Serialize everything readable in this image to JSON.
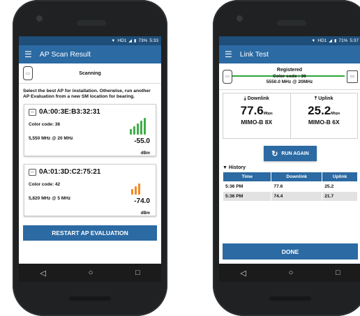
{
  "left": {
    "status": {
      "network": "HD1",
      "battery": "73%",
      "time": "5:33"
    },
    "appbar_title": "AP Scan Result",
    "scan_status": "Scanning",
    "instructions": "Select the best AP for installation. Otherwise, run another AP Evaluation from a new SM location for bearing.",
    "ap_list": [
      {
        "mac": "0A:00:3E:B3:32:31",
        "color_code": "Color code: 36",
        "freq": "5,550 MHz @ 20 MHz",
        "rssi": "-55.0",
        "unit": "dBm",
        "signal_color": "#3fae49",
        "bars": 5
      },
      {
        "mac": "0A:01:3D:C2:75:21",
        "color_code": "Color code: 42",
        "freq": "5,820 MHz @ 5 MHz",
        "rssi": "-74.0",
        "unit": "dBm",
        "signal_color": "#f08a24",
        "bars": 3
      }
    ],
    "restart_label": "RESTART AP EVALUATION",
    "nav": {
      "back": "◁",
      "home": "○",
      "recent": "□"
    }
  },
  "right": {
    "status": {
      "network": "HD1",
      "battery": "71%",
      "time": "5:37"
    },
    "appbar_title": "Link Test",
    "reg_status": "Registered",
    "color_code": "Color code : 36",
    "freq": "5550.0 MHz @ 20MHz",
    "downlink": {
      "label": "Downlink",
      "value": "77.6",
      "unit": "Mbps",
      "mimo": "MIMO-B 8X"
    },
    "uplink": {
      "label": "Uplink",
      "value": "25.2",
      "unit": "Mbps",
      "mimo": "MIMO-B 6X"
    },
    "run_again_label": "RUN AGAIN",
    "history_label": "History",
    "history_headers": [
      "Time",
      "Downlink",
      "Uplink"
    ],
    "history_rows": [
      [
        "5:36 PM",
        "77.6",
        "25.2"
      ],
      [
        "5:36 PM",
        "74.4",
        "21.7"
      ]
    ],
    "done_label": "DONE",
    "nav": {
      "back": "◁",
      "home": "○",
      "recent": "□"
    }
  },
  "colors": {
    "primary": "#2b6aa3",
    "status_bar": "#1e4e79",
    "link_line": "#2aa63b"
  }
}
